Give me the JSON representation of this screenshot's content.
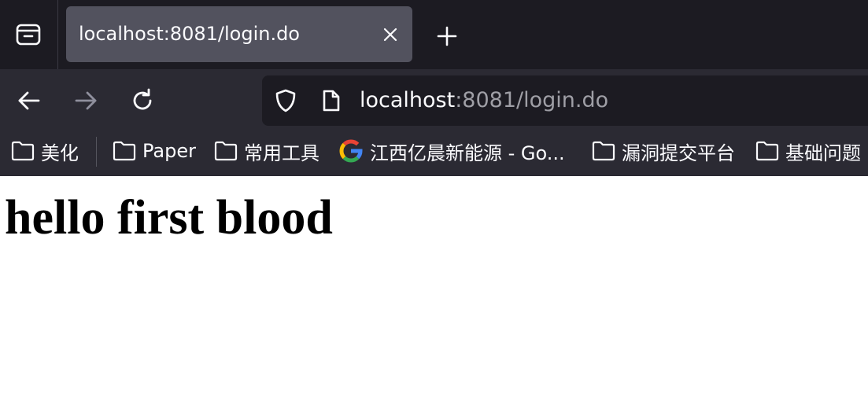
{
  "tab": {
    "title": "localhost:8081/login.do"
  },
  "address_bar": {
    "host": "localhost",
    "rest": ":8081/login.do"
  },
  "bookmarks": [
    {
      "label": "美化",
      "icon": "folder-icon"
    },
    {
      "label": "Paper",
      "icon": "folder-icon"
    },
    {
      "label": "常用工具",
      "icon": "folder-icon"
    },
    {
      "label": "江西亿晨新能源 - Go...",
      "icon": "google-icon"
    },
    {
      "label": "漏洞提交平台",
      "icon": "folder-icon"
    },
    {
      "label": "基础问题",
      "icon": "folder-icon"
    }
  ],
  "page": {
    "heading": "hello first blood"
  },
  "colors": {
    "tabbar_bg": "#1c1b22",
    "active_tab_bg": "#52525e",
    "toolbar_bg": "#2b2a33",
    "urlbar_bg": "#1c1b22",
    "text_light": "#fbfbfe",
    "text_dim": "#9f9fa6"
  }
}
